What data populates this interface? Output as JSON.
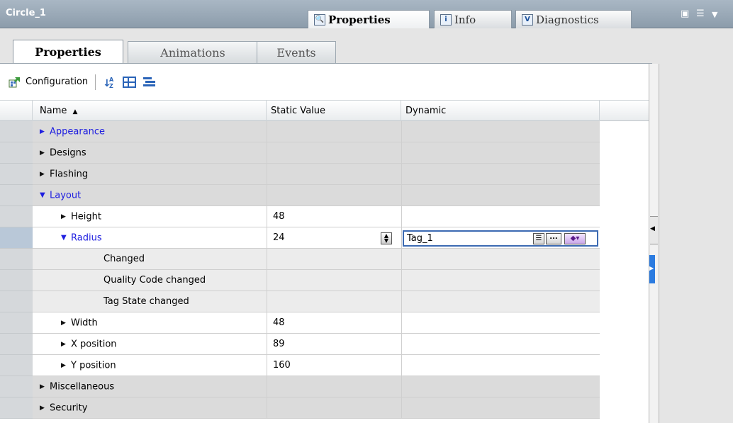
{
  "window": {
    "title": "Circle_1",
    "panel_tabs": [
      {
        "label": "Properties",
        "icon": "properties-icon"
      },
      {
        "label": "Info",
        "icon": "info-icon"
      },
      {
        "label": "Diagnostics",
        "icon": "diagnostics-icon"
      }
    ]
  },
  "tabs": [
    "Properties",
    "Animations",
    "Events"
  ],
  "toolbar": {
    "configuration_label": "Configuration"
  },
  "grid": {
    "headers": {
      "name": "Name",
      "static": "Static Value",
      "dynamic": "Dynamic"
    },
    "rows": [
      {
        "name": "Appearance",
        "static": "",
        "dynamic": ""
      },
      {
        "name": "Designs",
        "static": "",
        "dynamic": ""
      },
      {
        "name": "Flashing",
        "static": "",
        "dynamic": ""
      },
      {
        "name": "Layout",
        "static": "",
        "dynamic": ""
      },
      {
        "name": "Height",
        "static": "48",
        "dynamic": ""
      },
      {
        "name": "Radius",
        "static": "24",
        "dynamic": "Tag_1"
      },
      {
        "name": "Changed",
        "static": "",
        "dynamic": ""
      },
      {
        "name": "Quality Code changed",
        "static": "",
        "dynamic": ""
      },
      {
        "name": "Tag State changed",
        "static": "",
        "dynamic": ""
      },
      {
        "name": "Width",
        "static": "48",
        "dynamic": ""
      },
      {
        "name": "X position",
        "static": "89",
        "dynamic": ""
      },
      {
        "name": "Y position",
        "static": "160",
        "dynamic": ""
      },
      {
        "name": "Miscellaneous",
        "static": "",
        "dynamic": ""
      },
      {
        "name": "Security",
        "static": "",
        "dynamic": ""
      }
    ],
    "tag_dots": "..."
  },
  "colors": {
    "link_blue": "#2020e0",
    "header_bar": "#8c9cab",
    "selection": "#b9c8d8"
  }
}
